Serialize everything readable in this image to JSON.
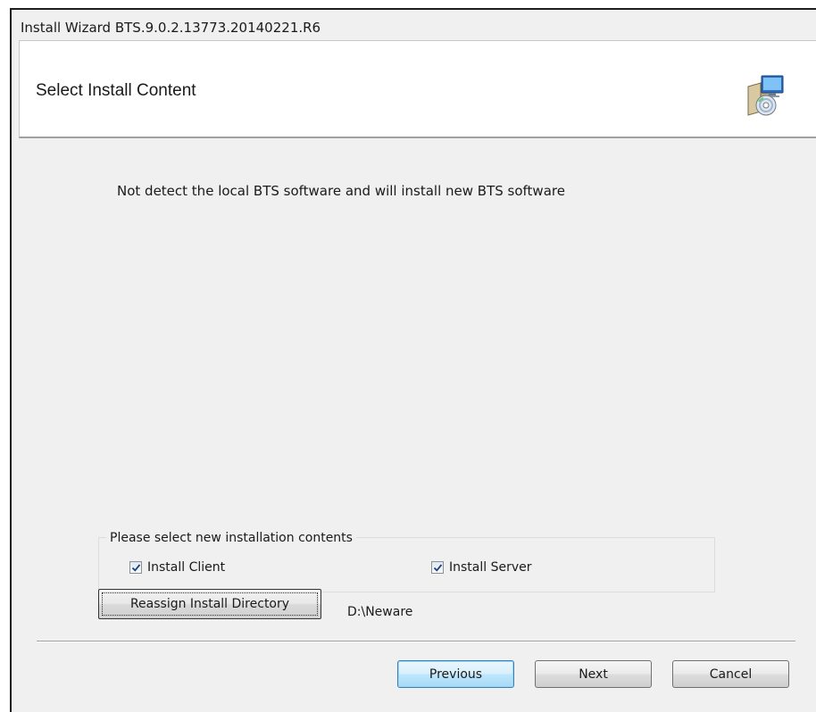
{
  "window": {
    "title": "Install Wizard BTS.9.0.2.13773.20140221.R6"
  },
  "header": {
    "title": "Select Install Content",
    "icon": "installer-computer-cd-icon"
  },
  "body": {
    "info_text": "Not detect the local BTS software and will install new BTS software"
  },
  "group": {
    "label": "Please select new installation contents",
    "install_client": {
      "label": "Install Client",
      "checked": true
    },
    "install_server": {
      "label": "Install Server",
      "checked": true
    }
  },
  "directory": {
    "button_label": "Reassign Install Directory",
    "path": "D:\\Neware"
  },
  "footer": {
    "previous_label": "Previous",
    "next_label": "Next",
    "cancel_label": "Cancel"
  },
  "colors": {
    "window_bg": "#f0f0f0",
    "header_bg": "#ffffff",
    "focused_button_border": "#3c7fb1",
    "checkbox_mark": "#1f3f7a"
  }
}
